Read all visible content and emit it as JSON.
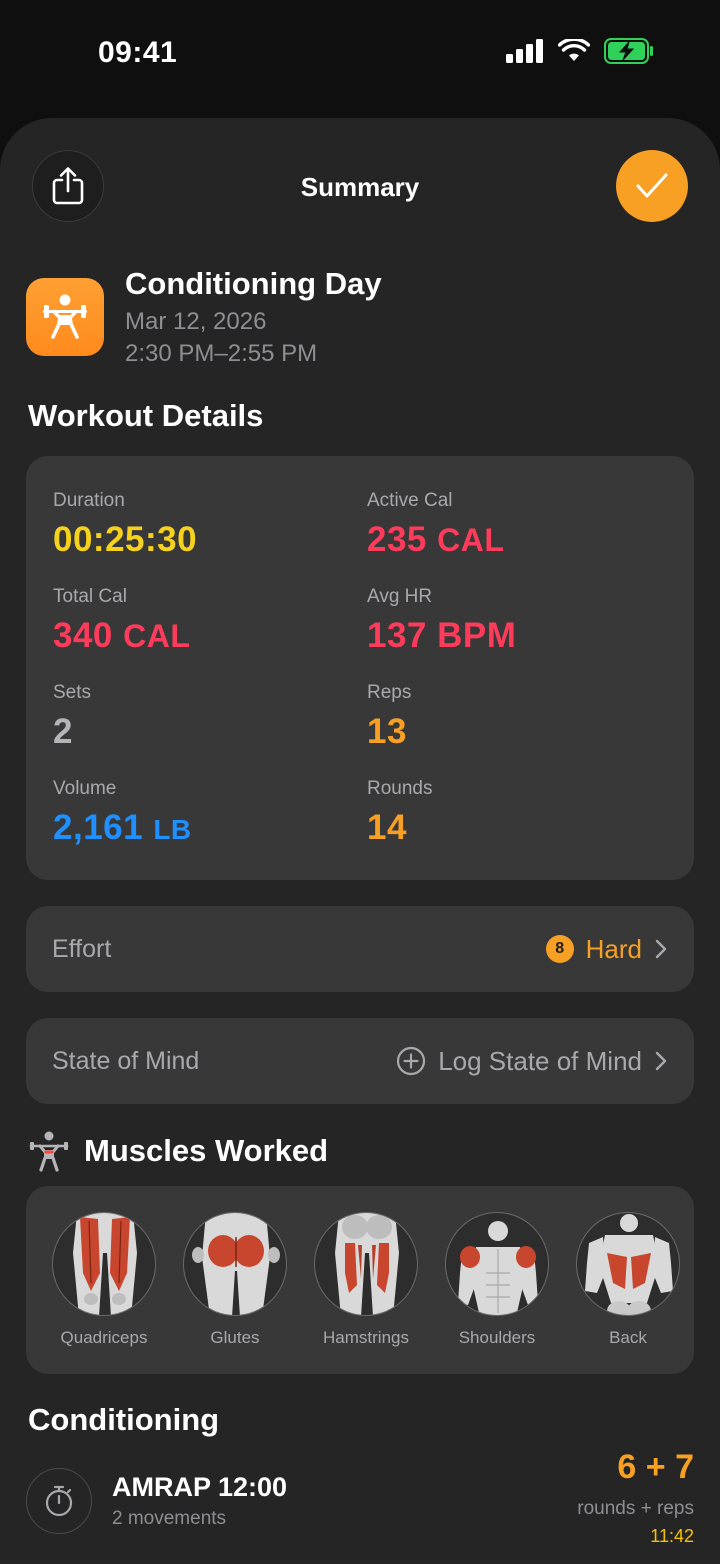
{
  "status_bar": {
    "time": "09:41"
  },
  "header": {
    "title": "Summary"
  },
  "workout": {
    "name": "Conditioning Day",
    "date": "Mar 12, 2026",
    "time_range": "2:30 PM–2:55 PM",
    "icon": "weightlifting-icon"
  },
  "details": {
    "section_title": "Workout Details",
    "duration": {
      "label": "Duration",
      "value": "00:25:30",
      "color": "#f7d21d"
    },
    "active_cal": {
      "label": "Active Cal",
      "value": "235",
      "unit": "CAL",
      "color": "#ff3b5c"
    },
    "total_cal": {
      "label": "Total Cal",
      "value": "340",
      "unit": "CAL",
      "color": "#ff3b5c"
    },
    "avg_hr": {
      "label": "Avg HR",
      "value": "137",
      "unit": "BPM",
      "color": "#ff3b5c"
    },
    "sets": {
      "label": "Sets",
      "value": "2",
      "color": "#b5b5b9"
    },
    "reps": {
      "label": "Reps",
      "value": "13",
      "color": "#f7a023"
    },
    "volume": {
      "label": "Volume",
      "value": "2,161",
      "unit": "LB",
      "color": "#1e90ff"
    },
    "rounds": {
      "label": "Rounds",
      "value": "14",
      "color": "#f7a023"
    }
  },
  "effort": {
    "label": "Effort",
    "score": "8",
    "value": "Hard"
  },
  "state_of_mind": {
    "label": "State of Mind",
    "action": "Log State of Mind"
  },
  "muscles": {
    "title": "Muscles Worked",
    "items": [
      {
        "name": "Quadriceps",
        "icon": "quadriceps-icon"
      },
      {
        "name": "Glutes",
        "icon": "glutes-icon"
      },
      {
        "name": "Hamstrings",
        "icon": "hamstrings-icon"
      },
      {
        "name": "Shoulders",
        "icon": "shoulders-icon"
      },
      {
        "name": "Back",
        "icon": "back-icon"
      }
    ]
  },
  "conditioning": {
    "section_title": "Conditioning",
    "item": {
      "title": "AMRAP 12:00",
      "subtitle": "2 movements",
      "score": "6 + 7",
      "score_label": "rounds + reps",
      "elapsed": "11:42"
    }
  },
  "colors": {
    "accent": "#f7a023",
    "sheet": "#252525",
    "card": "#383838"
  }
}
